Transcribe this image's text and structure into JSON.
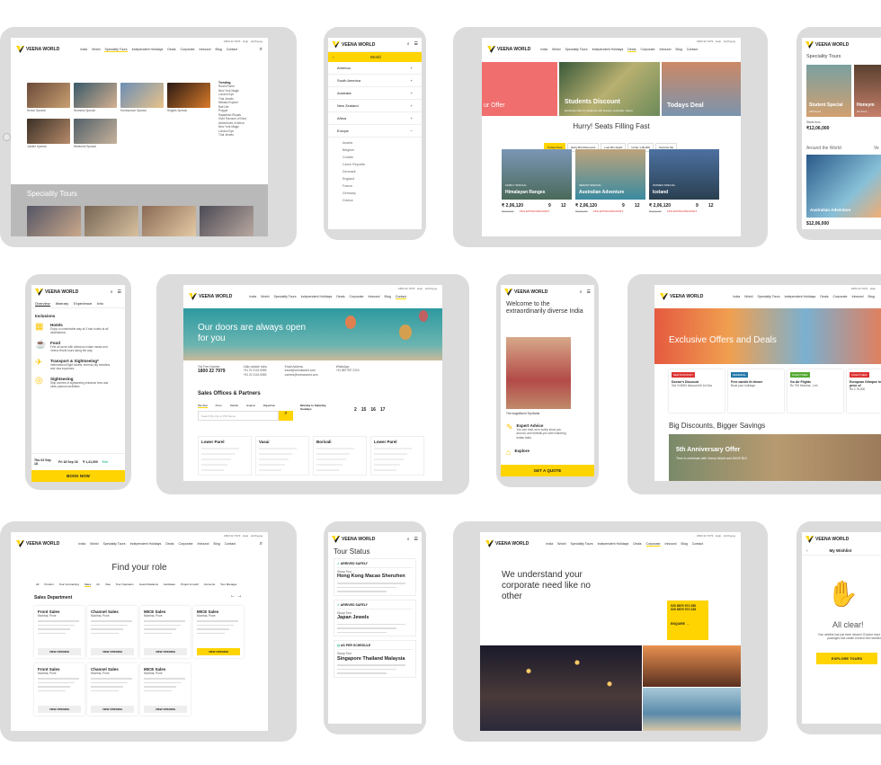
{
  "brand": {
    "name": "VEENA WORLD",
    "accent": "#ffd400",
    "dark": "#222222"
  },
  "topbar": {
    "phone": "1800 22 7979",
    "help": "Help",
    "user": "Hi,Prayog"
  },
  "nav": [
    "India",
    "World",
    "Speciality Tours",
    "Independent Holidays",
    "Deals",
    "Corporate",
    "Inbound",
    "Blog",
    "Contact"
  ],
  "s1": {
    "tiles": [
      "Senior Special",
      "Womens Special",
      "Honeymoon Special",
      "Singles Special",
      "Jubilee Special",
      "Weekend Special"
    ],
    "trending_title": "Trending",
    "trending": [
      "Roam Rome",
      "New York Magic",
      "London Eye",
      "Thai Jewels",
      "Melaka Explore",
      "Bali Life",
      "Prague",
      "Rajasthan Royals",
      "Vivid Flavours of East",
      "Adventures of Africa",
      "New York Magic",
      "London Eye",
      "Thai Jewels"
    ],
    "section": "Speciality Tours"
  },
  "s2": {
    "title": "World",
    "items": [
      "America",
      "South America",
      "Australia",
      "New Zealand",
      "Africa",
      "Europe"
    ],
    "sub": [
      "Austria",
      "Belgium",
      "Croatia",
      "Czech Republic",
      "Denmark",
      "England",
      "France",
      "Germany",
      "Greece"
    ]
  },
  "s3": {
    "hero1": "ur Offer",
    "hero2": "Students Discount",
    "hero2_sub": "Exclusive offer for students with Europe, Australia, Japan.",
    "hero3": "Todays Deal",
    "heading": "Hurry! Seats Filling Fast",
    "tabs": [
      "Todays Deal",
      "Early Bird Discounts",
      "Last Min Deals",
      "Under 1,00,000",
      "Surprise Me"
    ],
    "cards": [
      {
        "tag": "FAMILY SPECIAL",
        "title": "Himalayan Ranges",
        "price": "₹ 2,06,120",
        "old": "₹3,00,000",
        "disc": "15% EXTRA DISCOUNT",
        "c": "9",
        "d": "12"
      },
      {
        "tag": "SENIOR SPECIAL",
        "title": "Australian Adventure",
        "price": "₹ 2,06,120",
        "old": "₹3,00,000",
        "disc": "15% EXTRA DISCOUNT",
        "c": "9",
        "d": "12"
      },
      {
        "tag": "WOMEN SPECIAL",
        "title": "Iceland",
        "price": "₹ 2,06,120",
        "old": "₹3,00,000",
        "disc": "15% EXTRA DISCOUNT",
        "c": "9",
        "d": "12"
      }
    ]
  },
  "s4": {
    "title": "Speciality Tours",
    "card1": "Student Special",
    "card1_sub": "218 Tours",
    "card2": "Honeym",
    "card2_sub": "16 Tours",
    "price1": "₹12,06,000",
    "price1_sub": "Starts from",
    "section": "Around the World",
    "section2": "Ve",
    "dest": "Australian Adventure",
    "price2": "$12,06,000"
  },
  "s5": {
    "tabs": [
      "Overview",
      "Itinerary",
      "Experience",
      "Info"
    ],
    "title": "Inclusions",
    "items": [
      {
        "t": "Hotels",
        "d": "Enjoy a comfortable stay at 3 star hotels at all destinations"
      },
      {
        "t": "Food",
        "d": "Feel at home with delicious Indian meals and Veena World tours along the way"
      },
      {
        "t": "Transport & Sightseeing*",
        "d": "International flight tickets, internal city transfers and visa expenses"
      },
      {
        "t": "Sightseeing",
        "d": "Skip worries of sightseeing entrance fees and other planned activities"
      }
    ],
    "d1": "Thu 02 Sep 18",
    "d2": "Fri 18 Sep 18",
    "price": "₹ 1,41,000",
    "edit": "Edit",
    "cta": "BOOK NOW"
  },
  "s6": {
    "hero": "Our doors are always open for you",
    "c1l": "Toll-Free Number",
    "c1": "1800 22 7979",
    "c2l": "Calls outside India",
    "c2": "+91 22 2101 6969\n+91 22 2101 6969",
    "c3l": "Email Address",
    "c3": "travel@veenaworld.com\ncareers@veenaworld.com",
    "c4l": "WhatsApp",
    "c4": "+91 887 997 2220",
    "section": "Sales Offices & Partners",
    "tabs": [
      "Mumbai",
      "Pune",
      "Nashik",
      "Gujarat",
      "Rajasthan"
    ],
    "search": "Search By City or PIN Name",
    "hours": "Monday to Saturday",
    "hours2": "Sundays",
    "days": [
      "2",
      "15",
      "16",
      "17"
    ],
    "offices": [
      "Lower Parel",
      "Vasai",
      "Borivali",
      "Lower Parel"
    ]
  },
  "s7": {
    "title": "Welcome to the extraordinarily diverse India",
    "caption": "The magnificent Taj Mahal",
    "f1": "Expert Advice",
    "f1d": "You can trust us to solely show you around, and enthrall you with charming Indian tales.",
    "f2": "Explore",
    "cta": "GET A QUOTE"
  },
  "s8": {
    "hero": "Exclusive Offers and Deals",
    "offers": [
      {
        "tag": "NEW DISCOUNT",
        "t": "Doctor's Discount",
        "d": "Get ₹15000 discount till 1st Dec"
      },
      {
        "tag": "REFERRAL",
        "t": "Free candle lit dinner",
        "d": "Book your holidays"
      },
      {
        "tag": "FLIGHT DEAL",
        "t": "Go Air Flights",
        "d": "Rs 790 Mumbai - Leh"
      },
      {
        "tag": "FLIGHT DEAL",
        "t": "European Glimpse Inclusive price of",
        "d": "Rs 2,75,000"
      }
    ],
    "section": "Big Discounts, Bigger Savings",
    "promo": "5th Anniversary Offer",
    "promo_sub": "Time to celebrate with Veena World and SAVE BIG"
  },
  "s9": {
    "title": "Find your role",
    "filters": [
      "All",
      "Product",
      "Tour Contracting",
      "Sales",
      "Air",
      "Visa",
      "Tour Operators",
      "Guest Relations",
      "Hardware",
      "Project & Audit",
      "Accounts",
      "Tour Manager"
    ],
    "dept": "Sales Department",
    "jobs": [
      {
        "t": "Front Sales",
        "l": "Mumbai, Pune"
      },
      {
        "t": "Channel Sales",
        "l": "Mumbai, Pune"
      },
      {
        "t": "MICE Sales",
        "l": "Mumbai, Pune"
      },
      {
        "t": "MICE Sales",
        "l": "Mumbai, Pune"
      },
      {
        "t": "Front Sales",
        "l": "Mumbai, Pune"
      },
      {
        "t": "Channel Sales",
        "l": "Mumbai, Pune"
      },
      {
        "t": "MICE Sales",
        "l": "Mumbai, Pune"
      }
    ],
    "view": "VIEW OPENING"
  },
  "s10": {
    "title": "Tour Status",
    "tours": [
      {
        "status": "ARRIVED SAFELY",
        "g": "Group Tour",
        "n": "Hong Kong Macao Shenzhen"
      },
      {
        "status": "ARRIVED SAFELY",
        "g": "Group Tour",
        "n": "Japan Jewels"
      },
      {
        "status": "AS PER SCHEDULE",
        "g": "Group Tour",
        "n": "Singapore Thailand Malaysia"
      }
    ]
  },
  "s11": {
    "title": "We understand your corporate need like no other",
    "phone1": "020 8879 972 280",
    "phone2": "020 8879 972 245",
    "cta": "ENQUIRE →"
  },
  "s12": {
    "title": "My Wishlist",
    "headline": "All clear!",
    "sub": "Your wishlist has just been cleared. Explore more holiday packages and create a brand new wishlist",
    "cta": "EXPLORE TOURS"
  }
}
